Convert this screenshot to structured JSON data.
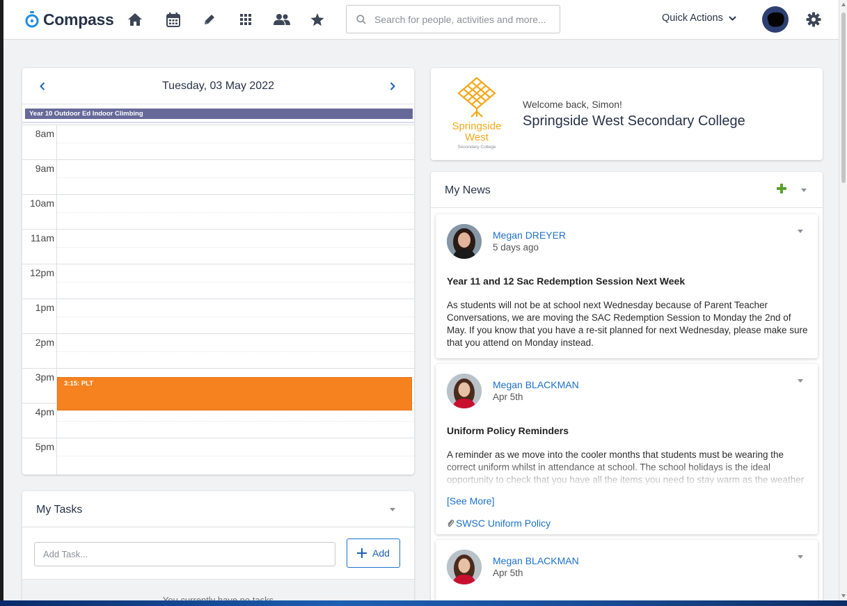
{
  "app": {
    "name": "Compass"
  },
  "nav": {
    "icons": [
      "home-icon",
      "calendar-icon",
      "pencil-icon",
      "apps-grid-icon",
      "people-icon",
      "star-icon"
    ],
    "search_placeholder": "Search for people, activities and more...",
    "quick_actions_label": "Quick Actions"
  },
  "calendar": {
    "date_label": "Tuesday, 03 May 2022",
    "all_day_event": "Year 10 Outdoor Ed Indoor Climbing",
    "hours": [
      "8am",
      "9am",
      "10am",
      "11am",
      "12pm",
      "1pm",
      "2pm",
      "3pm",
      "4pm",
      "5pm"
    ],
    "events": [
      {
        "label": "3:15: PLT",
        "color": "#f5821f"
      }
    ]
  },
  "tasks": {
    "title": "My Tasks",
    "input_placeholder": "Add Task...",
    "add_label": "Add",
    "empty_text": "You currently have no tasks"
  },
  "welcome": {
    "greeting": "Welcome back, Simon!",
    "school_name": "Springside West Secondary College",
    "logo_line1": "Springside",
    "logo_line2": "West",
    "logo_line3": "Secondary College"
  },
  "news": {
    "title": "My News",
    "items": [
      {
        "author": "Megan DREYER",
        "time": "5 days ago",
        "heading": "Year 11 and 12 Sac Redemption Session Next Week",
        "body": "As students will not be at school next Wednesday because of Parent Teacher Conversations, we are moving the SAC Redemption Session to Monday the 2nd of May. If you know that you have a re-sit planned for next Wednesday, please make sure that you attend on Monday instead."
      },
      {
        "author": "Megan BLACKMAN",
        "time": "Apr 5th",
        "heading": "Uniform Policy Reminders",
        "body": "A reminder as we move into the cooler months that students must be wearing the correct uniform whilst in attendance at school. The school holidays is the ideal opportunity to check that you have all the items you need to stay warm as the weather",
        "see_more": "[See More]",
        "attachment": "SWSC Uniform Policy"
      },
      {
        "author": "Megan BLACKMAN",
        "time": "Apr 5th"
      }
    ]
  },
  "colors": {
    "brand_navy": "#283347",
    "link_blue": "#1d70c9",
    "event_orange": "#f5821f",
    "allday_purple": "#676a99",
    "plus_green": "#5aa02c"
  }
}
